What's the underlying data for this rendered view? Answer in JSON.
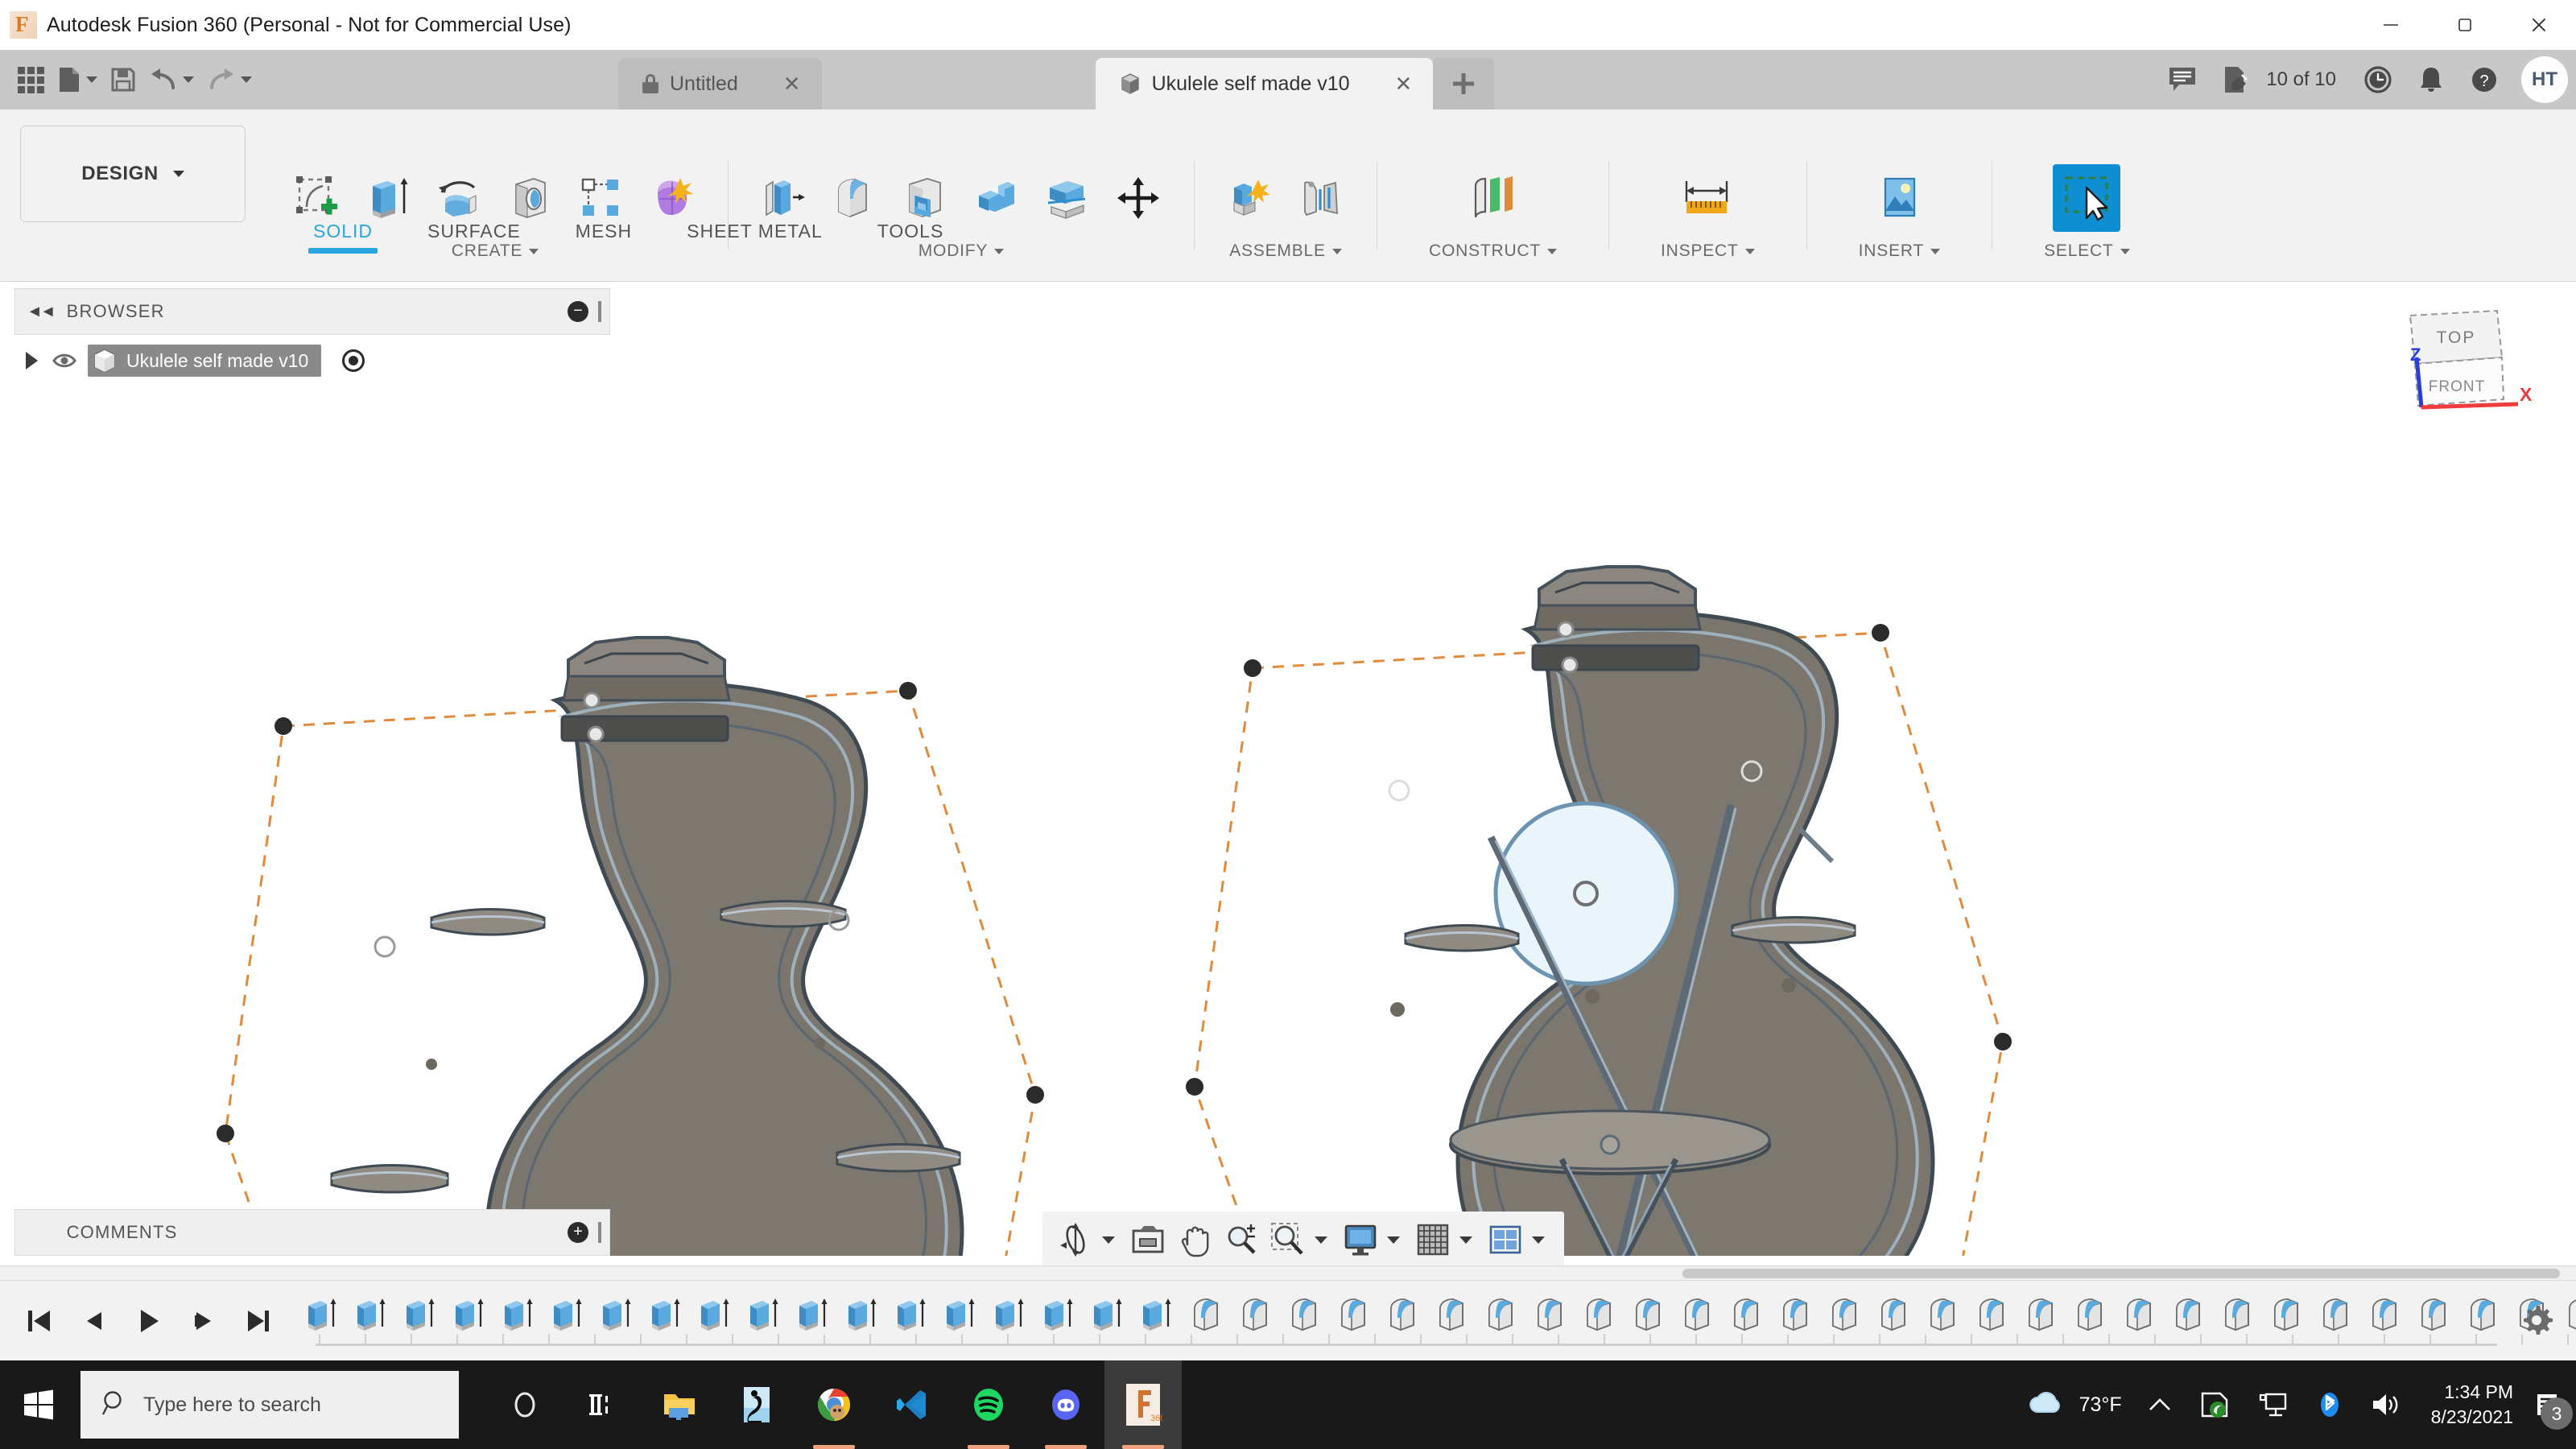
{
  "window": {
    "title": "Autodesk Fusion 360 (Personal - Not for Commercial Use)",
    "app_icon": "fusion360-logo-icon",
    "minimize": "─",
    "maximize": "❐",
    "close": "✕"
  },
  "quick_access": {
    "app_grid": "app-grid-icon",
    "new_file": "new-file-icon",
    "save": "save-icon",
    "undo": "undo-icon",
    "redo": "redo-icon"
  },
  "tabs": [
    {
      "label": "Untitled",
      "icon": "lock-icon",
      "active": false,
      "close": "✕"
    },
    {
      "label": "Ukulele self made v10",
      "icon": "component-cube-icon",
      "active": true,
      "close": "✕"
    }
  ],
  "tab_actions": {
    "new_tab": "+",
    "comments_icon": "comment-icon",
    "version_icon": "document-edit-icon",
    "version_label": "10 of 10",
    "history_icon": "clock-icon",
    "notifications_icon": "bell-icon",
    "help_icon": "help-icon",
    "avatar_initials": "HT"
  },
  "ribbon": {
    "workspace": "DESIGN",
    "workspace_caret": "▾",
    "tabs": [
      {
        "label": "SOLID",
        "active": true
      },
      {
        "label": "SURFACE",
        "active": false
      },
      {
        "label": "MESH",
        "active": false
      },
      {
        "label": "SHEET METAL",
        "active": false
      },
      {
        "label": "TOOLS",
        "active": false
      }
    ],
    "groups": [
      {
        "label": "CREATE",
        "tools": [
          "create-sketch-icon",
          "extrude-icon",
          "revolve-icon",
          "hole-icon",
          "pattern-icon",
          "form-icon"
        ]
      },
      {
        "label": "MODIFY",
        "tools": [
          "press-pull-icon",
          "fillet-icon",
          "shell-icon",
          "combine-icon",
          "split-body-icon",
          "move-copy-icon"
        ]
      },
      {
        "label": "ASSEMBLE",
        "tools": [
          "new-component-icon",
          "joint-icon"
        ]
      },
      {
        "label": "CONSTRUCT",
        "tools": [
          "offset-plane-icon"
        ]
      },
      {
        "label": "INSPECT",
        "tools": [
          "measure-icon"
        ]
      },
      {
        "label": "INSERT",
        "tools": [
          "insert-image-icon"
        ]
      },
      {
        "label": "SELECT",
        "tools": [
          "select-cursor-icon"
        ],
        "selected": true
      }
    ]
  },
  "browser": {
    "title": "BROWSER",
    "collapse_icon": "double-chevron-left-icon",
    "minus_icon": "−",
    "grip_icon": "panel-resize-grip",
    "root": {
      "expand_icon": "expand-arrow-icon",
      "visibility_icon": "eye-icon",
      "type_icon": "component-cube-icon",
      "label": "Ukulele self made v10",
      "activate_icon": "activate-radio-icon"
    }
  },
  "comments": {
    "title": "COMMENTS",
    "add_icon": "+",
    "grip_icon": "panel-resize-grip"
  },
  "viewcube": {
    "top_face": "TOP",
    "front_face": "FRONT",
    "z_axis": "Z",
    "x_axis": "X",
    "z_color": "#2b3fd8",
    "x_color": "#ef3b3b"
  },
  "canvas": {
    "background": "#ffffff",
    "body_fill": "#7a756d",
    "body_edge": "#4f5a63",
    "selection_color": "#e08a3c",
    "soundhole_fill": "#e9f4fb",
    "models": [
      {
        "name": "ukulele-back-body",
        "label": "Ukulele back body (left view)"
      },
      {
        "name": "ukulele-front-body",
        "label": "Ukulele front body with sound hole (right view)"
      }
    ]
  },
  "navbar": {
    "tools": [
      {
        "name": "orbit-icon",
        "has_caret": true
      },
      {
        "name": "look-at-icon",
        "has_caret": false
      },
      {
        "name": "pan-icon",
        "has_caret": false
      },
      {
        "name": "zoom-icon",
        "has_caret": false
      },
      {
        "name": "fit-icon",
        "has_caret": true
      },
      {
        "name": "display-settings-icon",
        "has_caret": true
      },
      {
        "name": "grid-snaps-icon",
        "has_caret": true
      },
      {
        "name": "viewports-icon",
        "has_caret": true
      }
    ]
  },
  "timeline": {
    "controls": [
      "jump-to-beginning-icon",
      "step-back-icon",
      "play-icon",
      "step-forward-icon",
      "jump-to-end-icon"
    ],
    "settings_icon": "gear-icon",
    "features": [
      "extrude",
      "extrude",
      "extrude",
      "extrude",
      "extrude",
      "extrude",
      "extrude",
      "extrude",
      "extrude",
      "extrude",
      "extrude",
      "extrude",
      "extrude",
      "extrude",
      "extrude",
      "extrude",
      "extrude",
      "extrude",
      "fillet",
      "fillet",
      "fillet",
      "fillet",
      "fillet",
      "fillet",
      "fillet",
      "fillet",
      "fillet",
      "fillet",
      "fillet",
      "fillet",
      "fillet",
      "fillet",
      "fillet",
      "fillet",
      "fillet",
      "fillet",
      "fillet",
      "fillet",
      "fillet",
      "fillet",
      "fillet",
      "fillet",
      "fillet",
      "fillet",
      "fillet",
      "fillet",
      "fillet",
      "fillet",
      "fillet",
      "fillet",
      "fillet",
      "fillet",
      "fillet",
      "fillet",
      "fillet",
      "fillet"
    ]
  },
  "taskbar": {
    "start_icon": "windows-start-icon",
    "search_icon": "search-icon",
    "search_placeholder": "Type here to search",
    "apps": [
      {
        "name": "cortana-icon",
        "running": false,
        "active": false
      },
      {
        "name": "task-view-icon",
        "running": false,
        "active": false
      },
      {
        "name": "file-explorer-icon",
        "running": false,
        "active": false
      },
      {
        "name": "media-app-icon",
        "running": false,
        "active": false
      },
      {
        "name": "google-chrome-icon",
        "running": true,
        "active": false
      },
      {
        "name": "vs-code-icon",
        "running": false,
        "active": false
      },
      {
        "name": "spotify-icon",
        "running": true,
        "active": false
      },
      {
        "name": "discord-icon",
        "running": true,
        "active": false
      },
      {
        "name": "fusion360-taskbar-icon",
        "running": true,
        "active": true
      }
    ],
    "tray": {
      "weather_icon": "cloud-weather-icon",
      "weather_text": "73°F",
      "overflow_icon": "show-hidden-icons-chevron",
      "nvidia_icon": "nvidia-tray-icon",
      "network_icon": "network-tray-icon",
      "bluetooth_icon": "bluetooth-tray-icon",
      "volume_icon": "volume-tray-icon",
      "time": "1:34 PM",
      "date": "8/23/2021",
      "action_center_icon": "action-center-icon",
      "notification_count": "3"
    }
  }
}
